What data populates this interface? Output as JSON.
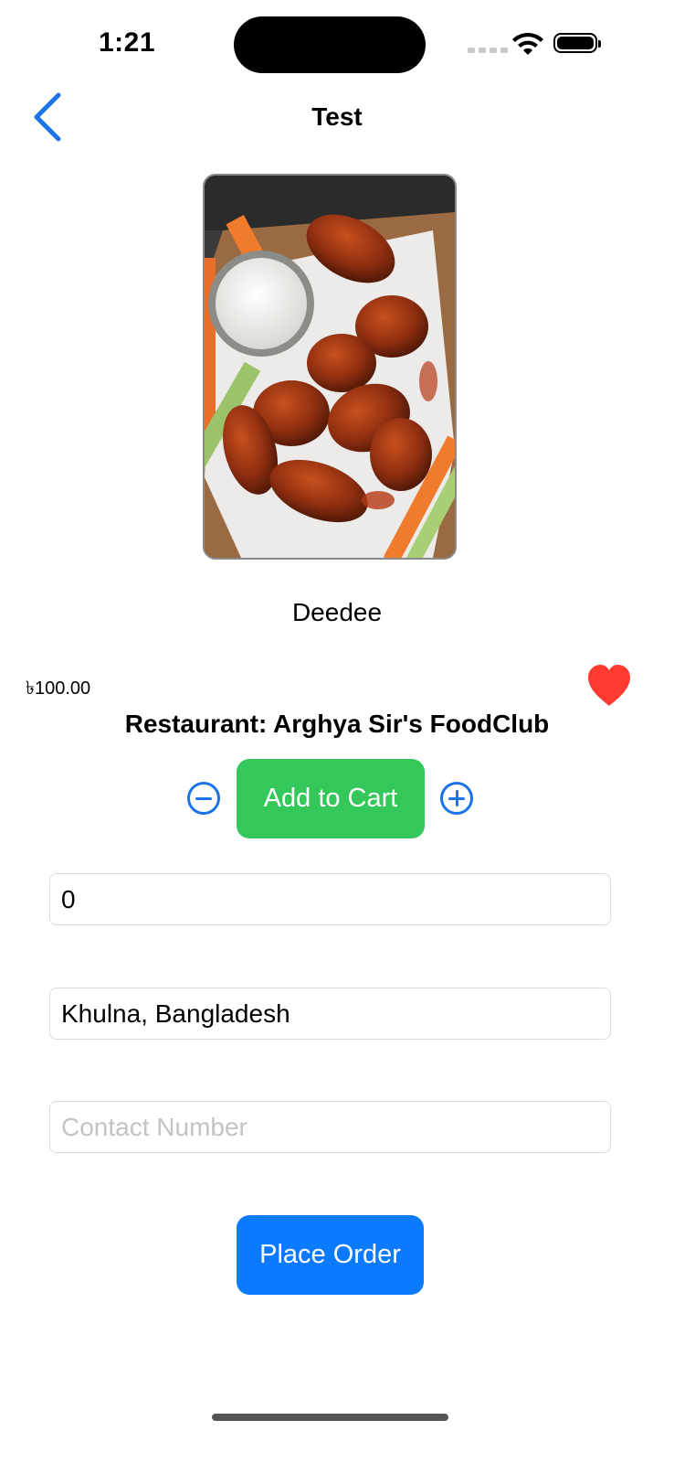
{
  "status_bar": {
    "time": "1:21"
  },
  "nav": {
    "title": "Test",
    "back_icon": "chevron-left-icon"
  },
  "product": {
    "image_alt": "Buffalo chicken wings with ranch dip, carrot and celery sticks",
    "name": "Deedee",
    "price": "৳100.00",
    "restaurant": "Restaurant: Arghya Sir's FoodClub",
    "favorite": true
  },
  "cart": {
    "add_label": "Add to Cart",
    "minus_icon": "minus-circle-icon",
    "plus_icon": "plus-circle-icon"
  },
  "form": {
    "quantity_value": "0",
    "address_value": "Khulna, Bangladesh",
    "contact_placeholder": "Contact Number",
    "contact_value": ""
  },
  "actions": {
    "place_order_label": "Place Order"
  },
  "colors": {
    "accent": "#0a7aff",
    "cart_green": "#34c759",
    "heart_red": "#ff3b30"
  }
}
